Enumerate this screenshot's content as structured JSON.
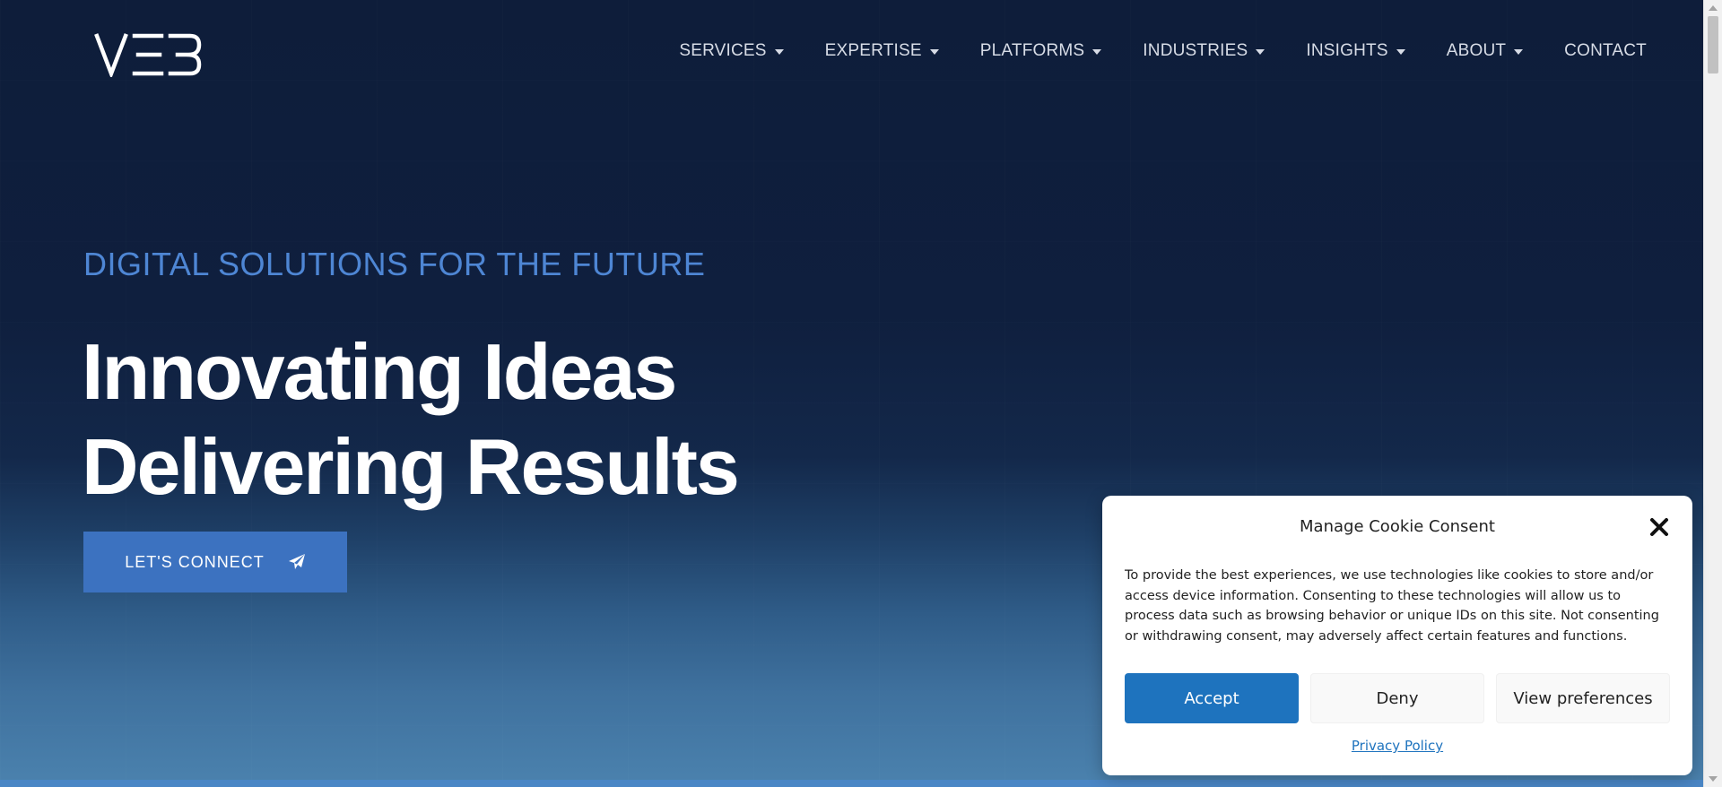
{
  "header": {
    "logo_text": "VE3",
    "nav": [
      {
        "label": "SERVICES",
        "has_dropdown": true
      },
      {
        "label": "EXPERTISE",
        "has_dropdown": true
      },
      {
        "label": "PLATFORMS",
        "has_dropdown": true
      },
      {
        "label": "INDUSTRIES",
        "has_dropdown": true
      },
      {
        "label": "INSIGHTS",
        "has_dropdown": true
      },
      {
        "label": "ABOUT",
        "has_dropdown": true
      },
      {
        "label": "CONTACT",
        "has_dropdown": false
      }
    ]
  },
  "hero": {
    "eyebrow": "DIGITAL SOLUTIONS FOR THE FUTURE",
    "headline_line1": "Innovating Ideas",
    "headline_line2": "Delivering Results",
    "cta_label": "LET'S CONNECT",
    "cta_icon": "paper-plane-icon"
  },
  "cookie_consent": {
    "title": "Manage Cookie Consent",
    "body": "To provide the best experiences, we use technologies like cookies to store and/or access device information. Consenting to these technologies will allow us to process data such as browsing behavior or unique IDs on this site. Not consenting or withdrawing consent, may adversely affect certain features and functions.",
    "accept_label": "Accept",
    "deny_label": "Deny",
    "preferences_label": "View preferences",
    "privacy_link": "Privacy Policy",
    "close_icon": "close-icon"
  },
  "colors": {
    "hero_top": "#0e1d3a",
    "hero_bottom": "#4b82ae",
    "eyebrow": "#4e86d4",
    "cta_bg": "#3c72c0",
    "accept_bg": "#1e73be",
    "link": "#1e73be"
  }
}
